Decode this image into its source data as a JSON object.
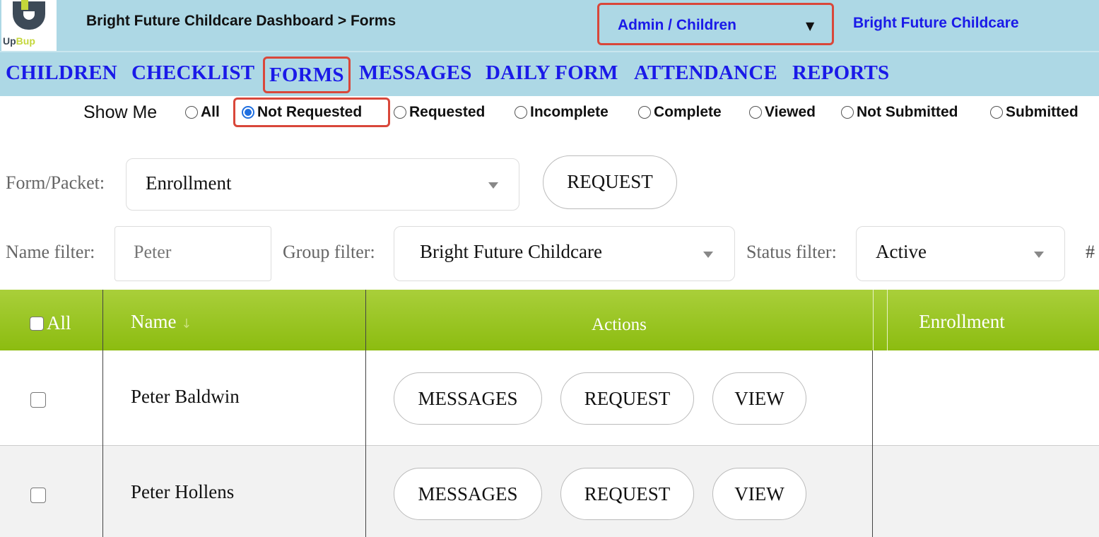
{
  "header": {
    "logo_text_up": "Up",
    "logo_text_bup": "Bup",
    "breadcrumb": "Bright Future Childcare Dashboard > Forms",
    "role_select": "Admin / Children",
    "org_link": "Bright Future Childcare"
  },
  "nav": {
    "items": [
      {
        "label": "CHILDREN"
      },
      {
        "label": "CHECKLIST"
      },
      {
        "label": "FORMS"
      },
      {
        "label": "MESSAGES"
      },
      {
        "label": "DAILY FORM"
      },
      {
        "label": "ATTENDANCE"
      },
      {
        "label": "REPORTS"
      }
    ],
    "active": "FORMS"
  },
  "show_me": {
    "label": "Show Me",
    "options": [
      {
        "label": "All",
        "checked": false
      },
      {
        "label": "Not Requested",
        "checked": true
      },
      {
        "label": "Requested",
        "checked": false
      },
      {
        "label": "Incomplete",
        "checked": false
      },
      {
        "label": "Complete",
        "checked": false
      },
      {
        "label": "Viewed",
        "checked": false
      },
      {
        "label": "Not Submitted",
        "checked": false
      },
      {
        "label": "Submitted",
        "checked": false
      }
    ]
  },
  "form_packet": {
    "label": "Form/Packet:",
    "value": "Enrollment",
    "request_button": "REQUEST"
  },
  "filters": {
    "name_label": "Name filter:",
    "name_value": "Peter",
    "group_label": "Group filter:",
    "group_value": "Bright Future Childcare",
    "status_label": "Status filter:",
    "status_value": "Active",
    "hash": "#"
  },
  "table": {
    "headers": {
      "all": "All",
      "name": "Name",
      "sort_indicator": "↓",
      "actions": "Actions",
      "enrollment": "Enrollment"
    },
    "rows": [
      {
        "name": "Peter Baldwin",
        "messages": "MESSAGES",
        "request": "REQUEST",
        "view": "VIEW"
      },
      {
        "name": "Peter Hollens",
        "messages": "MESSAGES",
        "request": "REQUEST",
        "view": "VIEW"
      }
    ]
  },
  "colors": {
    "header_bg": "#add8e5",
    "link_blue": "#1a1ae8",
    "table_header_green": "#8cbc10",
    "highlight_red": "#d9473a"
  }
}
